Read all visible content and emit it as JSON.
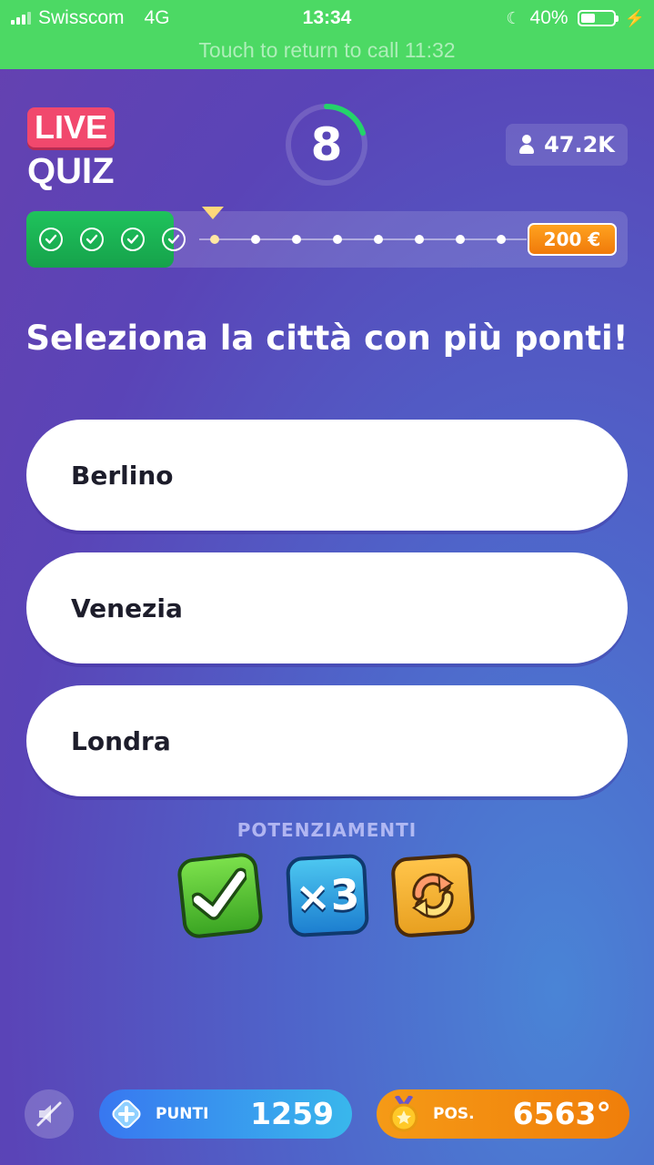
{
  "status_bar": {
    "carrier": "Swisscom",
    "network": "4G",
    "time": "13:34",
    "battery": "40%",
    "call_banner": "Touch to return to call 11:32"
  },
  "header": {
    "logo_top": "LIVE",
    "logo_bottom": "QUIZ",
    "timer": "8",
    "timer_fraction": 0.2,
    "viewers": "47.2K"
  },
  "progress": {
    "answered": 4,
    "total_questions": 12,
    "current_question": 5,
    "prize": "200 €"
  },
  "question": "Seleziona la città con più ponti!",
  "answers": [
    "Berlino",
    "Venezia",
    "Londra"
  ],
  "powerups": {
    "title": "POTENZIAMENTI",
    "extra_life_label": "×3"
  },
  "footer": {
    "points_label": "PUNTI",
    "points_value": "1259",
    "position_label": "POS.",
    "position_value": "6563°"
  },
  "colors": {
    "status_bar": "#4cd964",
    "progress_done": "#1fc35c",
    "prize": "#f07a0a",
    "timer_arc": "#24d36a"
  }
}
